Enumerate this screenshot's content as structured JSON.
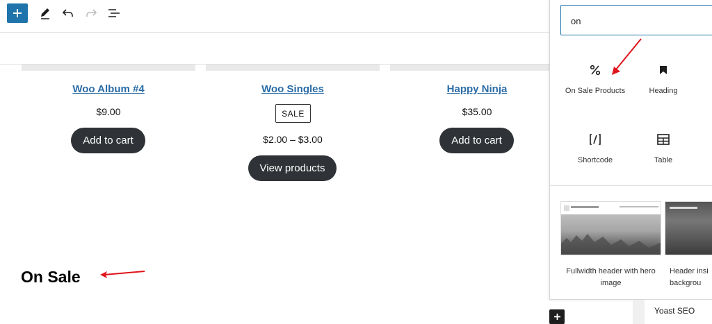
{
  "products": [
    {
      "title": "Woo Album #4",
      "price": "$9.00",
      "button": "Add to cart"
    },
    {
      "title": "Woo Singles",
      "badge": "SALE",
      "price": "$2.00 – $3.00",
      "button": "View products"
    },
    {
      "title": "Happy Ninja",
      "price": "$35.00",
      "button": "Add to cart"
    }
  ],
  "heading": "On Sale",
  "inserter": {
    "search_value": "on",
    "blocks": [
      {
        "label": "On Sale Products",
        "icon": "percent-icon"
      },
      {
        "label": "Heading",
        "icon": "bookmark-icon"
      },
      {
        "label": "Shortcode",
        "icon": "shortcode-icon"
      },
      {
        "label": "Table",
        "icon": "table-icon"
      }
    ],
    "patterns": [
      {
        "label": "Fullwidth header with hero image"
      },
      {
        "label": "Header insi backgrou"
      }
    ]
  },
  "sidebar": {
    "yoast_label": "Yoast SEO"
  },
  "colors": {
    "accent": "#1f74ac",
    "button_dark": "#2f3337",
    "link": "#2a6ca7",
    "annotation_arrow": "#e0131b"
  }
}
